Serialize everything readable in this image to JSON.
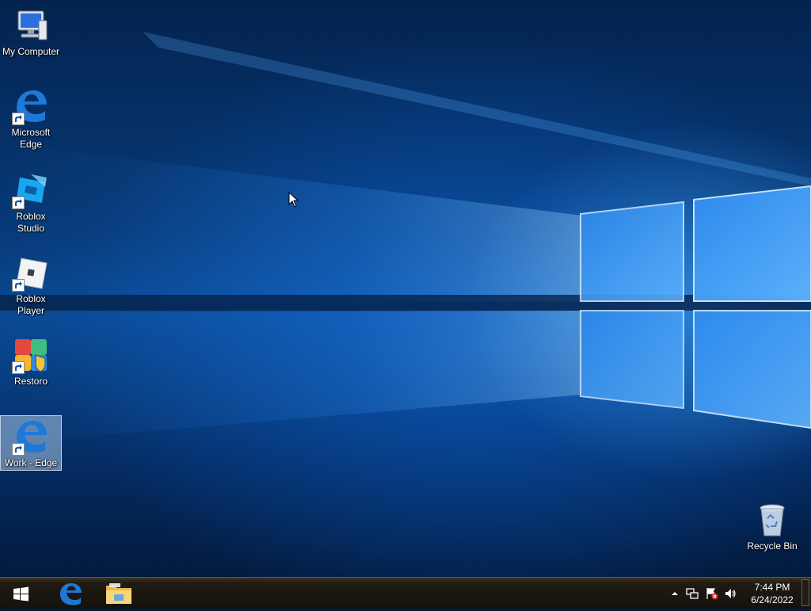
{
  "desktop": {
    "icons": [
      {
        "label": "My Computer",
        "icon": "computer-icon"
      },
      {
        "label": "Microsoft Edge",
        "icon": "edge-icon"
      },
      {
        "label": "Roblox Studio",
        "icon": "roblox-studio-icon"
      },
      {
        "label": "Roblox Player",
        "icon": "roblox-player-icon"
      },
      {
        "label": "Restoro",
        "icon": "restoro-icon"
      },
      {
        "label": "Work - Edge",
        "icon": "edge-icon",
        "selected": true
      },
      {
        "label": "Recycle Bin",
        "icon": "recycle-bin-icon"
      }
    ]
  },
  "taskbar": {
    "start_icon": "windows-logo-icon",
    "pinned": [
      {
        "name": "Microsoft Edge",
        "icon": "edge-icon"
      },
      {
        "name": "File Explorer",
        "icon": "folder-icon"
      }
    ],
    "tray": {
      "icons": [
        "chevron-up-icon",
        "network-icon",
        "action-center-flag-icon",
        "volume-icon"
      ],
      "time": "7:44 PM",
      "date": "6/24/2022"
    }
  },
  "colors": {
    "accent": "#1e78d7",
    "taskbar": "#1f1a12"
  }
}
